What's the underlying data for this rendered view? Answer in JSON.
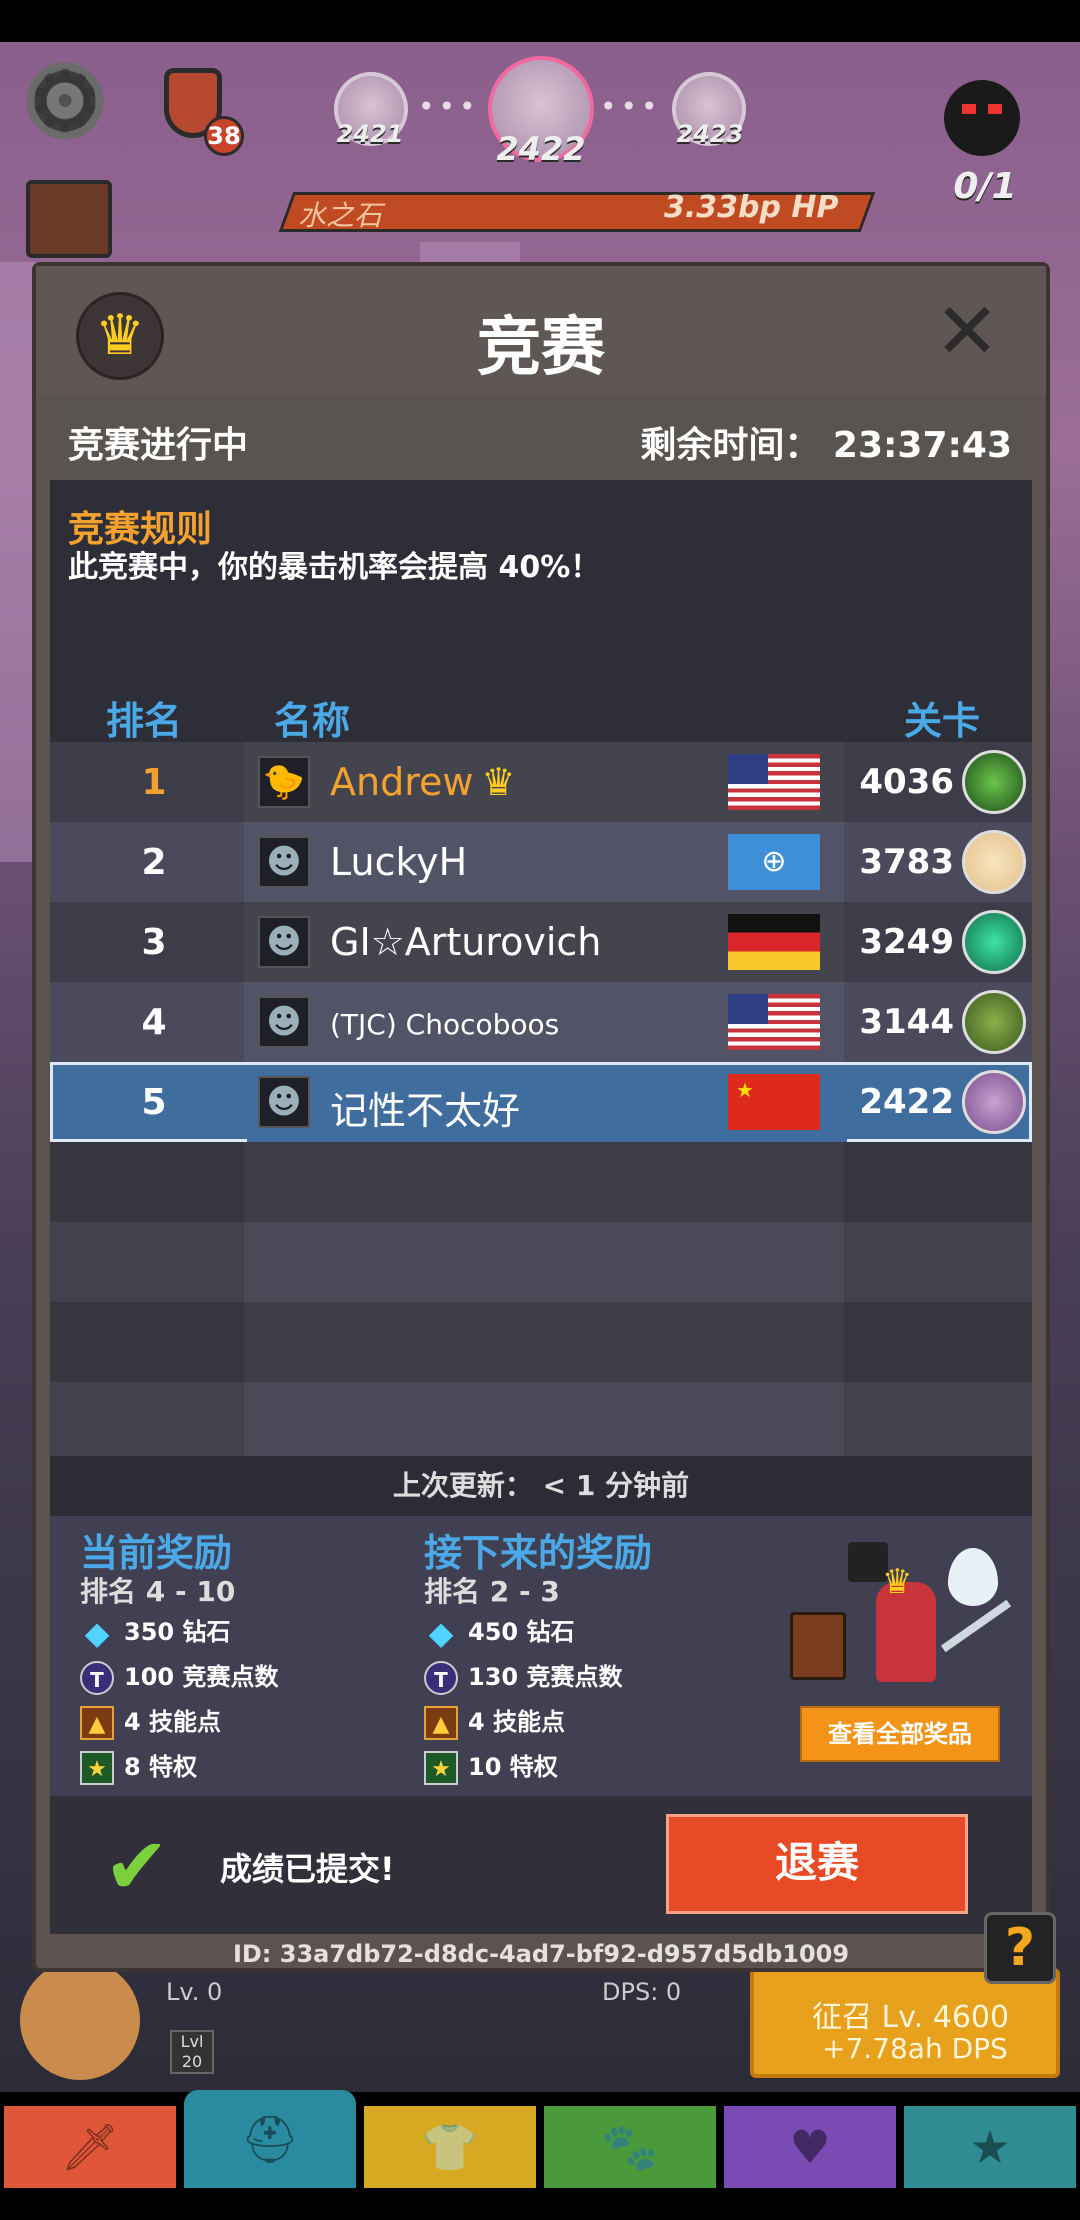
{
  "hud": {
    "level_badge": "38",
    "stages": [
      "2421",
      "2422",
      "2423"
    ],
    "boss_progress": "0/1",
    "enemy_name": "水之石",
    "enemy_hp": "3.33bp HP"
  },
  "modal": {
    "title": "竞赛",
    "status_label": "竞赛进行中",
    "time_left": "剩余时间：  23:37:43",
    "rules_title": "竞赛规则",
    "rules_text": "此竞赛中，你的暴击机率会提高 40%！",
    "columns": {
      "rank": "排名",
      "name": "名称",
      "stage": "关卡"
    },
    "rows": [
      {
        "rank": "1",
        "name": "Andrew",
        "flag": "us",
        "stage": "4036",
        "avatar": "chick-icon",
        "leader": true
      },
      {
        "rank": "2",
        "name": "LuckyH",
        "flag": "globe",
        "stage": "3783",
        "avatar": "goblin-icon"
      },
      {
        "rank": "3",
        "name": "GI☆Arturovich",
        "flag": "de",
        "stage": "3249",
        "avatar": "goblin-icon"
      },
      {
        "rank": "4",
        "name": "(TJC) Chocoboos",
        "flag": "us",
        "stage": "3144",
        "avatar": "goblin-icon"
      },
      {
        "rank": "5",
        "name": "记性不太好",
        "flag": "cn",
        "stage": "2422",
        "avatar": "goblin-icon",
        "me": true
      }
    ],
    "last_update": "上次更新：  < 1 分钟前",
    "current_reward": {
      "title": "当前奖励",
      "range": "排名 4 - 10",
      "items": [
        "350 钻石",
        "100 竞赛点数",
        "4 技能点",
        "8 特权"
      ]
    },
    "next_reward": {
      "title": "接下来的奖励",
      "range": "排名 2 - 3",
      "items": [
        "450 钻石",
        "130 竞赛点数",
        "4 技能点",
        "10 特权"
      ]
    },
    "view_all_label": "查看全部奖品",
    "submitted_text": "成绩已提交!",
    "quit_label": "退赛",
    "id_text": "ID: 33a7db72-d8dc-4ad7-bf92-d957d5db1009"
  },
  "hero": {
    "lv_label": "Lv. 0",
    "dps_label": "DPS: 0",
    "lvl_badge": "Lvl 20",
    "summon_line1": "征召 Lv. 4600",
    "summon_line2": "+7.78ah DPS"
  },
  "help_label": "?",
  "colors": {
    "accent_orange": "#f4a22f",
    "header_blue": "#4aa9e6",
    "quit_red": "#e84a25",
    "highlight_row": "#3e6d9e"
  }
}
